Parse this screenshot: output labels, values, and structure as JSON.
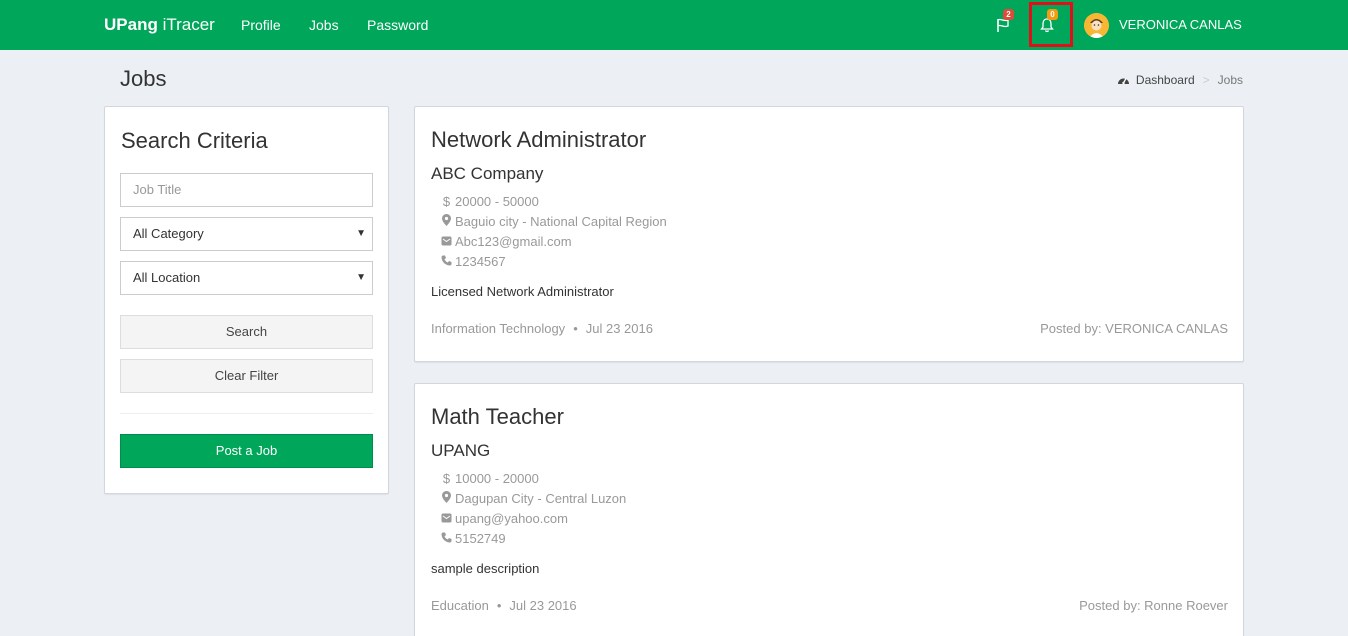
{
  "navbar": {
    "brand_bold": "UPang",
    "brand_light": " iTracer",
    "links": [
      "Profile",
      "Jobs",
      "Password"
    ],
    "flag_badge": "2",
    "bell_badge": "0",
    "user_name": "VERONICA CANLAS"
  },
  "header": {
    "title": "Jobs",
    "breadcrumb": [
      "Dashboard",
      "Jobs"
    ]
  },
  "search": {
    "title": "Search Criteria",
    "job_title_placeholder": "Job Title",
    "category_value": "All Category",
    "location_value": "All Location",
    "search_label": "Search",
    "clear_label": "Clear Filter",
    "post_label": "Post a Job"
  },
  "jobs": [
    {
      "title": "Network Administrator",
      "company": "ABC Company",
      "salary": "20000 - 50000",
      "location": "Baguio city - National Capital Region",
      "email": "Abc123@gmail.com",
      "phone": "1234567",
      "description": "Licensed Network Administrator",
      "category": "Information Technology",
      "date": "Jul 23 2016",
      "posted_by": "Posted by: VERONICA CANLAS"
    },
    {
      "title": "Math Teacher",
      "company": "UPANG",
      "salary": "10000 - 20000",
      "location": "Dagupan City - Central Luzon",
      "email": "upang@yahoo.com",
      "phone": "5152749",
      "description": "sample description",
      "category": "Education",
      "date": "Jul 23 2016",
      "posted_by": "Posted by: Ronne Roever"
    }
  ],
  "colors": {
    "navbar": "#00a65a",
    "background": "#ecf0f5",
    "highlight": "#e0101a"
  }
}
